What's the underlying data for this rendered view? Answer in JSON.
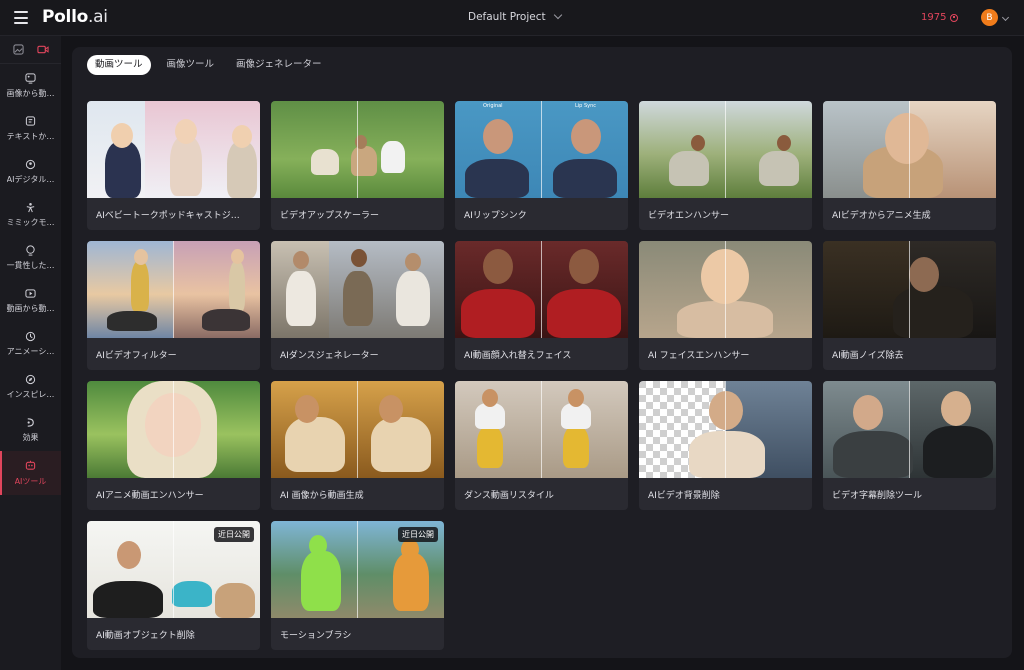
{
  "header": {
    "logo_main": "Pollo",
    "logo_suffix": ".ai",
    "project": "Default Project",
    "credits": "1975",
    "avatar_initial": "B"
  },
  "sidebar": {
    "items": [
      {
        "label": "画像から動…",
        "icon": "image-to-video-icon"
      },
      {
        "label": "テキストか…",
        "icon": "text-to-video-icon"
      },
      {
        "label": "AIデジタル…",
        "icon": "digital-human-icon"
      },
      {
        "label": "ミミックモ…",
        "icon": "mimic-motion-icon"
      },
      {
        "label": "一貫性した…",
        "icon": "consistent-character-icon"
      },
      {
        "label": "動画から動…",
        "icon": "video-to-video-icon"
      },
      {
        "label": "アニメーシ…",
        "icon": "animation-icon"
      },
      {
        "label": "インスピレ…",
        "icon": "inspiration-icon"
      },
      {
        "label": "効果",
        "icon": "effects-icon"
      },
      {
        "label": "AIツール",
        "icon": "ai-tools-icon"
      }
    ],
    "active_index": 9
  },
  "tabs": [
    "動画ツール",
    "画像ツール",
    "画像ジェネレーター"
  ],
  "cards": [
    {
      "label": "AIベビートークポッドキャストジ…"
    },
    {
      "label": "ビデオアップスケーラー"
    },
    {
      "label": "AIリップシンク",
      "left_caption": "Original",
      "right_caption": "Lip Sync"
    },
    {
      "label": "ビデオエンハンサー"
    },
    {
      "label": "AIビデオからアニメ生成"
    },
    {
      "label": "AIビデオフィルター"
    },
    {
      "label": "AIダンスジェネレーター"
    },
    {
      "label": "AI動画顔入れ替えフェイス"
    },
    {
      "label": "AI フェイスエンハンサー"
    },
    {
      "label": "AI動画ノイズ除去"
    },
    {
      "label": "AIアニメ動画エンハンサー"
    },
    {
      "label": "AI 画像から動画生成"
    },
    {
      "label": "ダンス動画リスタイル"
    },
    {
      "label": "AIビデオ背景削除"
    },
    {
      "label": "ビデオ字幕削除ツール"
    },
    {
      "label": "AI動画オブジェクト削除",
      "badge": "近日公開"
    },
    {
      "label": "モーションブラシ",
      "badge": "近日公開"
    }
  ],
  "colors": {
    "accent": "#e0455c",
    "avatar": "#f07c1b",
    "panel": "#1e1e24",
    "card": "#2a2a31"
  }
}
